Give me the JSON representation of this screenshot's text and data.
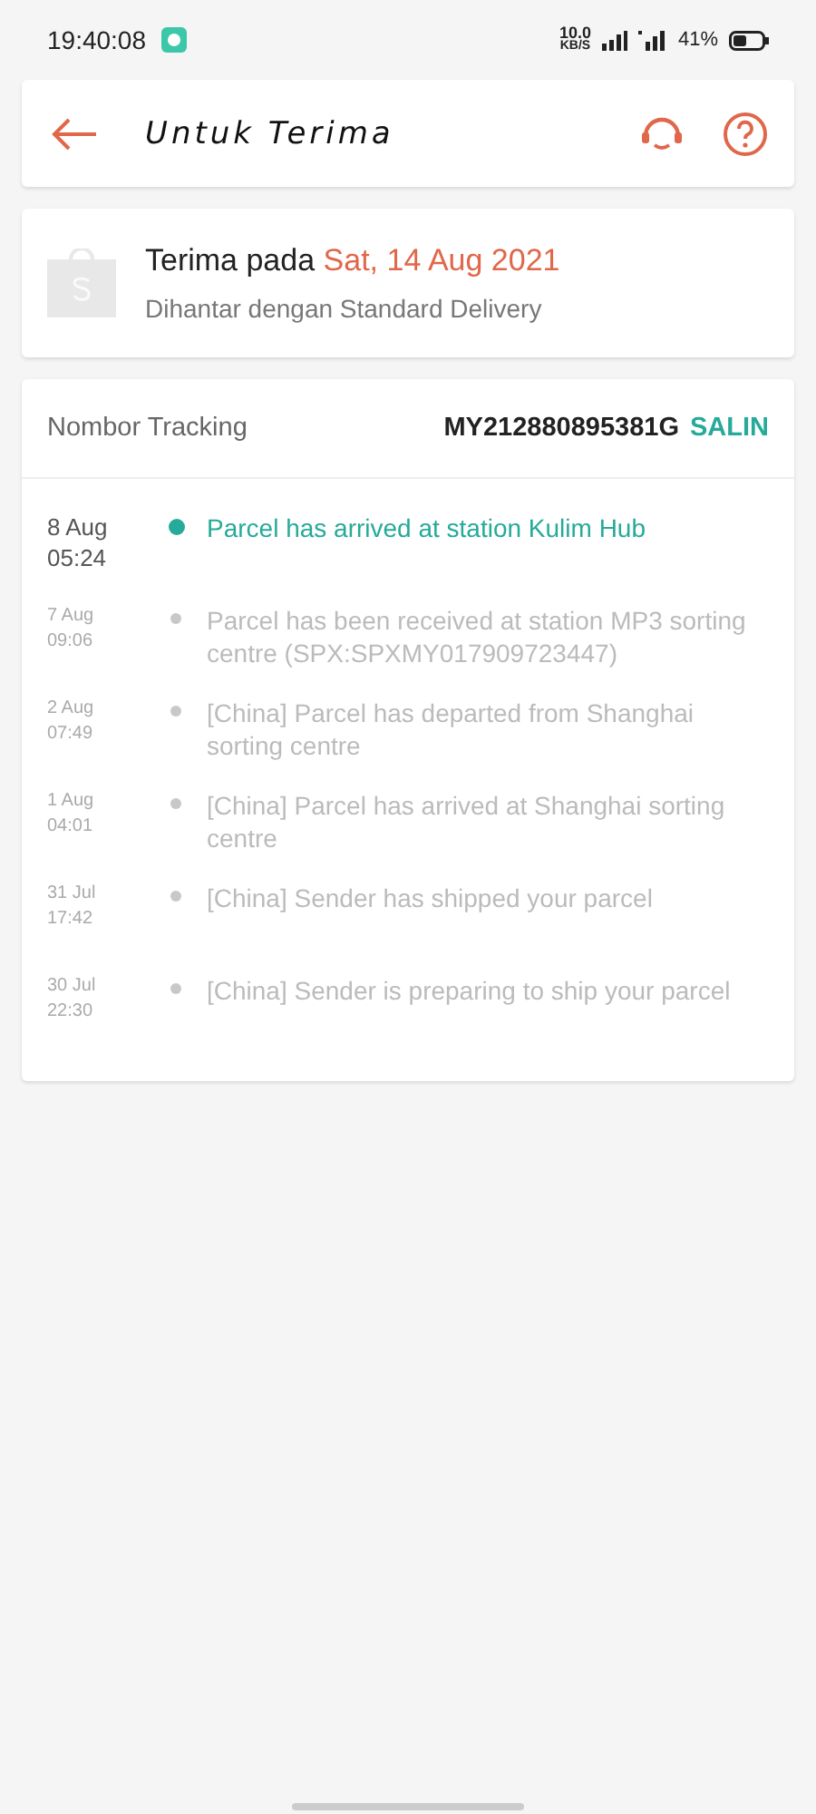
{
  "status_bar": {
    "time": "19:40:08",
    "speed": "10.0",
    "speed_unit": "KB/S",
    "battery": "41%"
  },
  "header": {
    "title": "Untuk Terima"
  },
  "delivery": {
    "label": "Terima pada",
    "date": "Sat, 14 Aug 2021",
    "subtitle": "Dihantar dengan Standard Delivery"
  },
  "tracking": {
    "label": "Nombor Tracking",
    "number": "MY212880895381G",
    "copy": "SALIN"
  },
  "events": [
    {
      "date": "8 Aug",
      "time": "05:24",
      "text": "Parcel has arrived at station Kulim Hub",
      "current": true
    },
    {
      "date": "7 Aug",
      "time": "09:06",
      "text": "Parcel has been received at station MP3 sorting centre (SPX:SPXMY017909723447)",
      "current": false
    },
    {
      "date": "2 Aug",
      "time": "07:49",
      "text": "[China] Parcel has departed from Shanghai sorting centre",
      "current": false
    },
    {
      "date": "1 Aug",
      "time": "04:01",
      "text": "[China] Parcel has arrived at Shanghai sorting centre",
      "current": false
    },
    {
      "date": "31 Jul",
      "time": "17:42",
      "text": "[China] Sender has shipped your parcel",
      "current": false
    },
    {
      "date": "30 Jul",
      "time": "22:30",
      "text": "[China] Sender is preparing to ship your parcel",
      "current": false
    }
  ]
}
